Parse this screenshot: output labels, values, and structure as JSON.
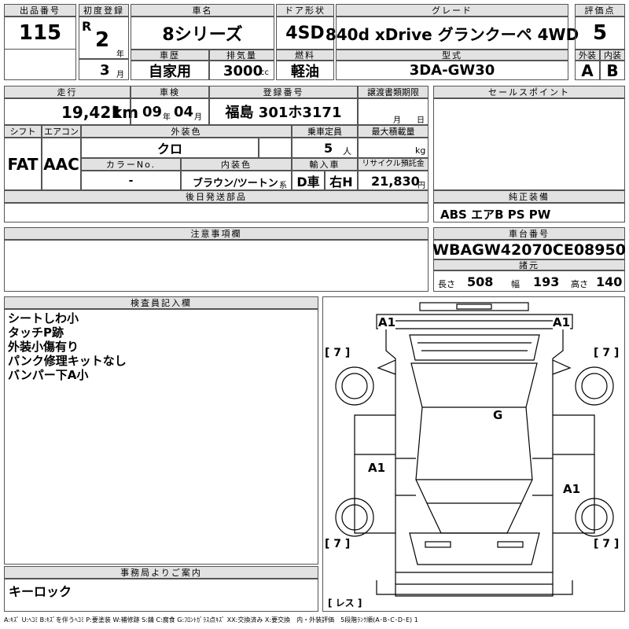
{
  "header": {
    "lot_label": "出品番号",
    "lot_no": "115",
    "reg_label": "初度登録",
    "era": "R",
    "year": "2",
    "year_unit": "年",
    "month": "3",
    "month_unit": "月",
    "name_label": "車名",
    "name": "8シリーズ",
    "door_label": "ドア形状",
    "door": "4SD",
    "grade_label": "グレード",
    "grade": "840d xDrive グランクーペ 4WD",
    "score_label": "評価点",
    "score": "5",
    "history_label": "車歴",
    "history": "自家用",
    "disp_label": "排気量",
    "disp": "3000",
    "disp_unit": "cc",
    "fuel_label": "燃料",
    "fuel": "軽油",
    "model_label": "型式",
    "model": "3DA-GW30",
    "ext_label": "外装",
    "ext": "A",
    "int_label": "内装",
    "int": "B"
  },
  "row2": {
    "mileage_label": "走行",
    "mileage": "19,421",
    "mileage_unit": "km",
    "inspect_label": "車検",
    "inspect_y": "09",
    "inspect_y_unit": "年",
    "inspect_m": "04",
    "inspect_m_unit": "月",
    "plate_label": "登録番号",
    "plate": "福島 301ホ3171",
    "transfer_label": "譲渡書類期限",
    "transfer_m": "月",
    "transfer_d": "日",
    "sales_label": "セールスポイント",
    "shift_label": "シフト",
    "shift": "FAT",
    "ac_label": "エアコン",
    "ac": "AAC",
    "color_label": "外装色",
    "color": "クロ",
    "capacity_label": "乗車定員",
    "capacity": "5",
    "capacity_unit": "人",
    "load_label": "最大積載量",
    "load_unit": "kg",
    "colorno_label": "カラーNo.",
    "colorno": "-",
    "interior_label": "内装色",
    "interior": "ブラウン/ツートン",
    "interior_unit": "系",
    "import_label": "輸入車",
    "import": "D車",
    "handle": "右H",
    "recycle_label": "リサイクル預託金",
    "recycle": "21,830",
    "recycle_unit": "円",
    "later_label": "後日発送部品",
    "equip_label": "純正装備",
    "equip": "ABS エアB PS PW"
  },
  "notes": {
    "label": "注意事項欄"
  },
  "chassis": {
    "label": "車台番号",
    "value": "WBAGW42070CE08950",
    "specs_label": "諸元",
    "length_label": "長さ",
    "length": "508",
    "width_label": "幅",
    "width": "193",
    "height_label": "高さ",
    "height": "140"
  },
  "inspector": {
    "label": "検査員記入欄",
    "lines": [
      "シートしわ小",
      "タッチP跡",
      "外装小傷有り",
      "パンク修理キットなし",
      "バンパー下A小"
    ]
  },
  "office": {
    "label": "事務局よりご案内",
    "text": "キーロック"
  },
  "diagram": {
    "marks": [
      "A1",
      "A1",
      "G",
      "A1",
      "A1"
    ],
    "tires": [
      "[ 7 ]",
      "[ 7 ]",
      "[ 7 ]",
      "[ 7 ]"
    ],
    "spare": "[ レス ]"
  },
  "legend": "A:ｷｽﾞ U:ﾍｺﾐ B:ｷｽﾞを伴うﾍｺﾐ P:要塗装 W:補修跡 S:錆 C:腐食 G:ﾌﾛﾝﾄｶﾞﾗｽ点ｷｽﾞ XX:交換済み X:要交換　内・外装評価　5段階ﾗﾝｸ順(A･B･C･D･E) 1"
}
